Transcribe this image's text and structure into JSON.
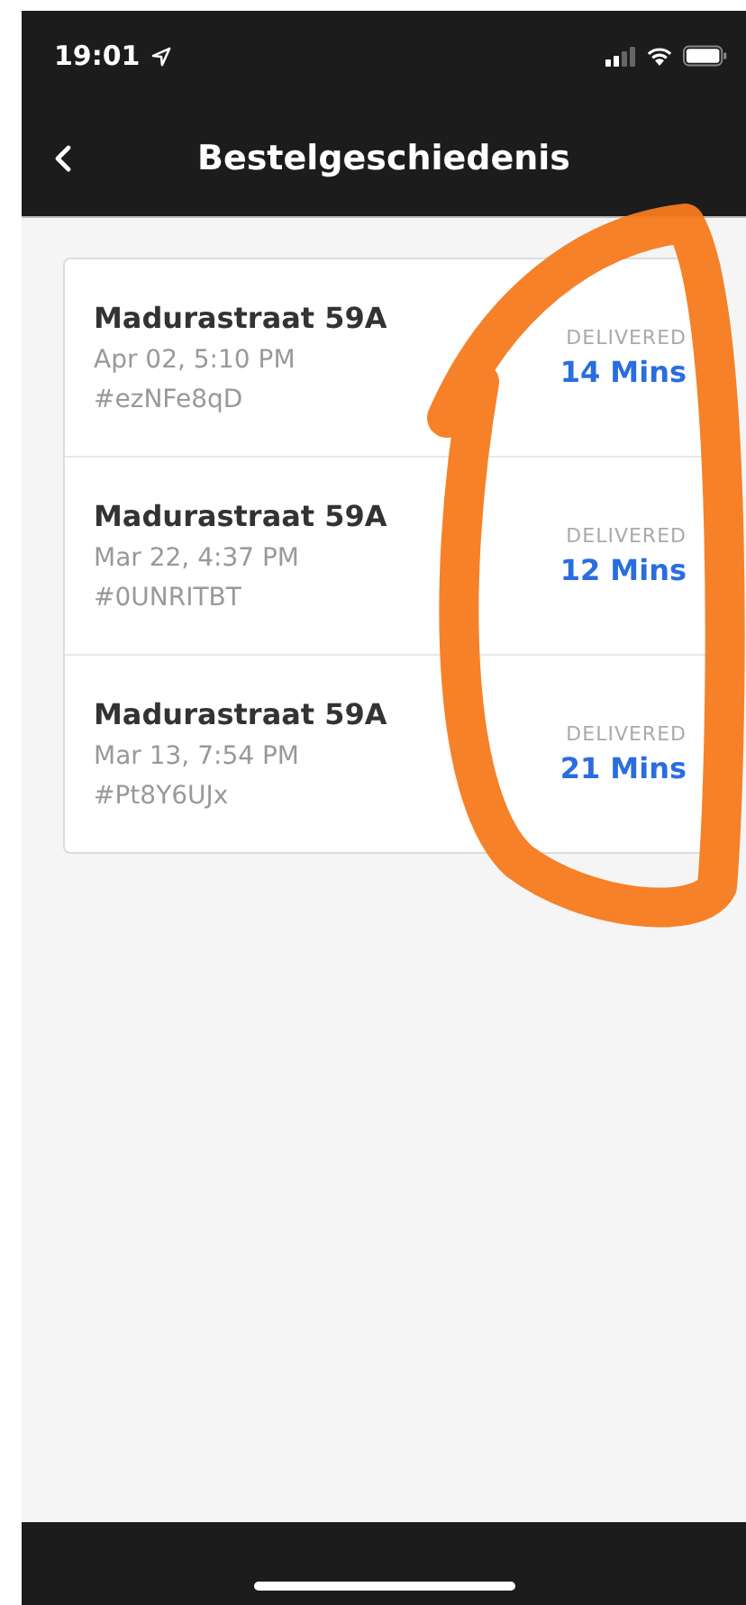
{
  "status_bar": {
    "time": "19:01"
  },
  "header": {
    "title": "Bestelgeschiedenis"
  },
  "orders": [
    {
      "address": "Madurastraat 59A",
      "date": "Apr 02, 5:10 PM",
      "order_id": "#ezNFe8qD",
      "status": "DELIVERED",
      "duration": "14 Mins"
    },
    {
      "address": "Madurastraat 59A",
      "date": "Mar 22, 4:37 PM",
      "order_id": "#0UNRITBT",
      "status": "DELIVERED",
      "duration": "12 Mins"
    },
    {
      "address": "Madurastraat 59A",
      "date": "Mar 13, 7:54 PM",
      "order_id": "#Pt8Y6UJx",
      "status": "DELIVERED",
      "duration": "21 Mins"
    }
  ]
}
